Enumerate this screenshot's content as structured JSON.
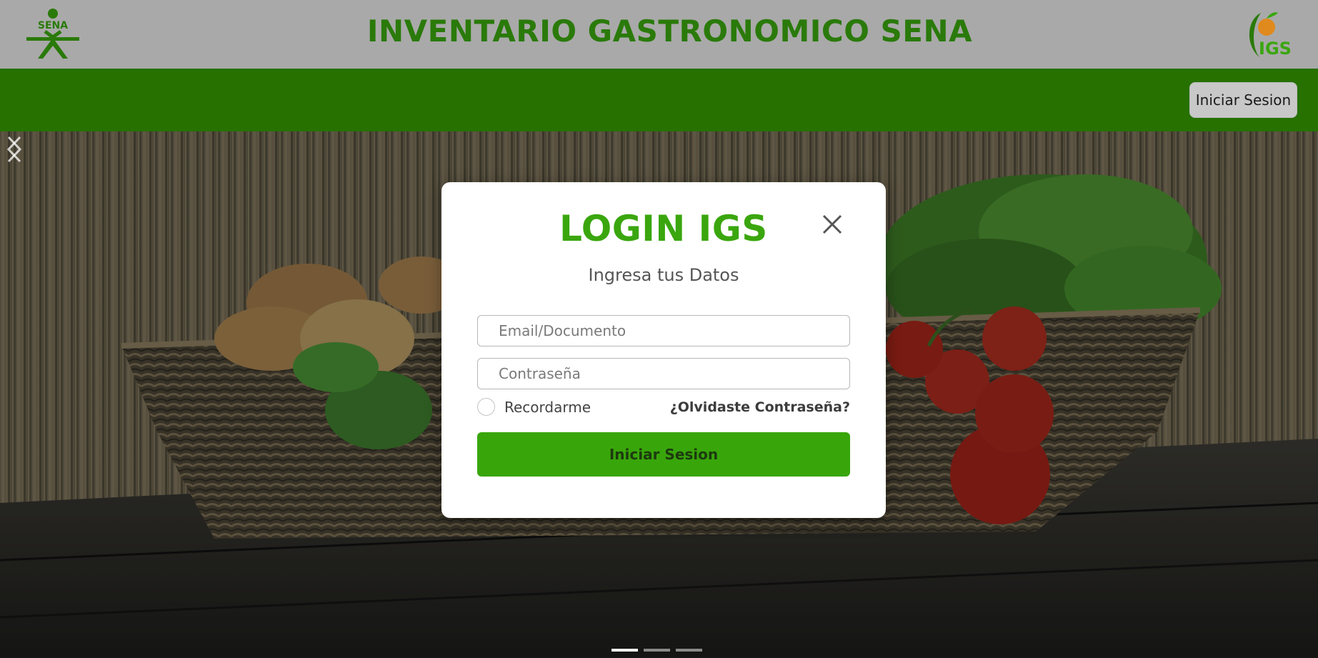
{
  "header": {
    "title": "INVENTARIO GASTRONOMICO SENA",
    "sena_logo_text": "SENA",
    "igs_logo_text": "IGS"
  },
  "navbar": {
    "login_button": "Iniciar Sesion"
  },
  "modal": {
    "title": "LOGIN IGS",
    "subtitle": "Ingresa tus Datos",
    "email_placeholder": "Email/Documento",
    "password_placeholder": "Contraseña",
    "remember_label": "Recordarme",
    "forgot_link": "¿Olvidaste Contraseña?",
    "submit_button": "Iniciar Sesion"
  },
  "carousel": {
    "indicator_count": 3,
    "active_index": 0
  },
  "colors": {
    "header_bg": "#a9a9a9",
    "brand_green": "#267100",
    "title_green": "#2a7a0a",
    "accent_green": "#38a60a"
  }
}
